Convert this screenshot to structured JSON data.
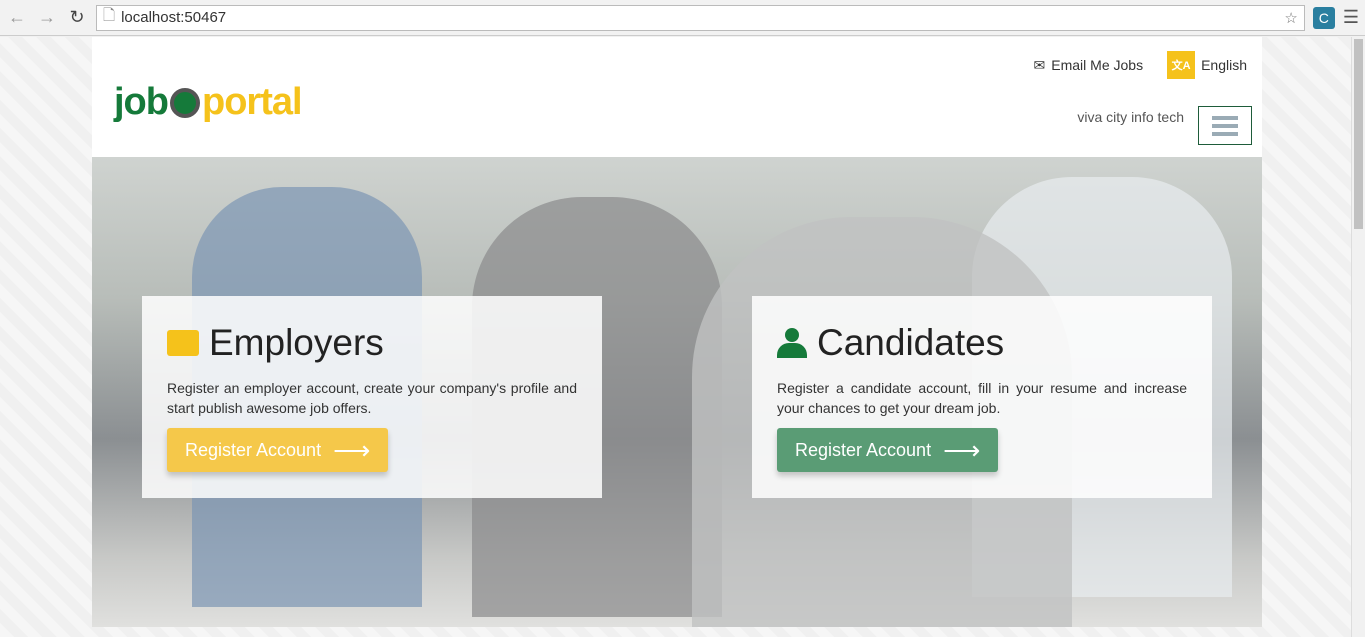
{
  "browser": {
    "url": "localhost:50467"
  },
  "header": {
    "logo_left": "job",
    "logo_right": "portal",
    "email_jobs": "Email Me Jobs",
    "language": "English",
    "company": "viva city info tech"
  },
  "employers": {
    "title": "Employers",
    "text": "Register an employer account, create your company's profile and start publish awesome job offers.",
    "button": "Register Account"
  },
  "candidates": {
    "title": "Candidates",
    "text": "Register a candidate account, fill in your resume and increase your chances to get your dream job.",
    "button": "Register Account"
  },
  "colors": {
    "green": "#157a3a",
    "yellow": "#f5c21b"
  }
}
